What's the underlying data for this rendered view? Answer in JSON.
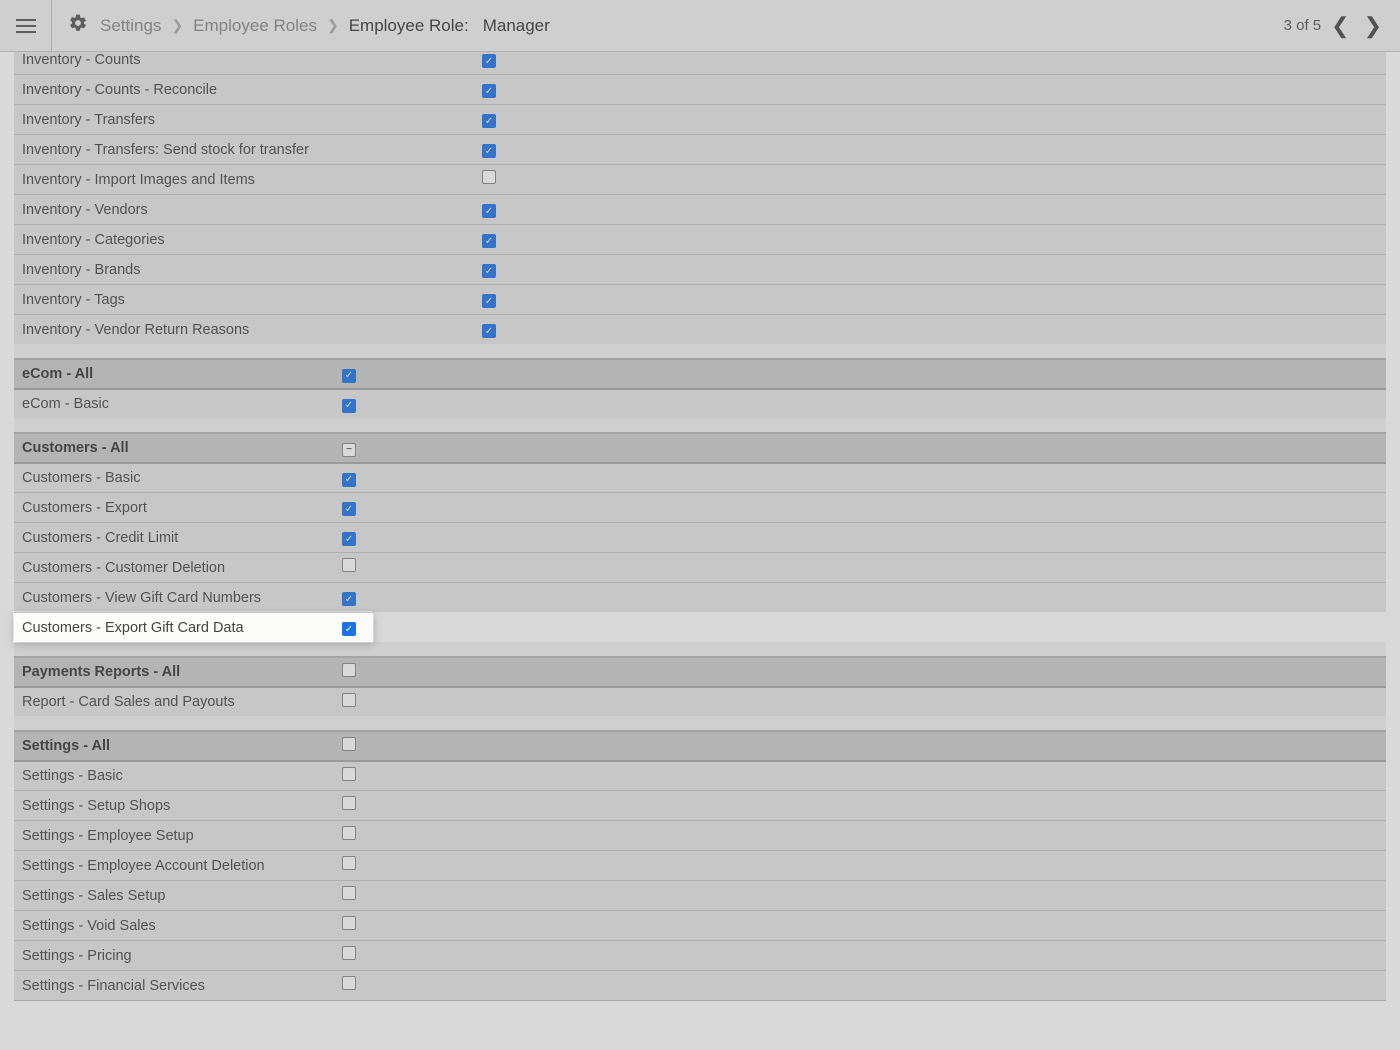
{
  "header": {
    "breadcrumb": {
      "l1": "Settings",
      "l2": "Employee Roles",
      "l3_label": "Employee Role:",
      "l3_value": "Manager"
    },
    "pager": {
      "text": "3 of 5"
    }
  },
  "sections": [
    {
      "kind": "group_continue",
      "rows": [
        {
          "label": "Inventory - Counts",
          "checked": true
        },
        {
          "label": "Inventory - Counts - Reconcile",
          "checked": true
        },
        {
          "label": "Inventory - Transfers",
          "checked": true
        },
        {
          "label": "Inventory - Transfers: Send stock for transfer",
          "checked": true
        },
        {
          "label": "Inventory - Import Images and Items",
          "checked": false
        },
        {
          "label": "Inventory - Vendors",
          "checked": true
        },
        {
          "label": "Inventory - Categories",
          "checked": true
        },
        {
          "label": "Inventory - Brands",
          "checked": true
        },
        {
          "label": "Inventory - Tags",
          "checked": true
        },
        {
          "label": "Inventory - Vendor Return Reasons",
          "checked": true
        }
      ]
    },
    {
      "kind": "section",
      "header": {
        "label": "eCom - All",
        "state": "checked"
      },
      "rows": [
        {
          "label": "eCom - Basic",
          "checked": true
        }
      ]
    },
    {
      "kind": "section",
      "header": {
        "label": "Customers - All",
        "state": "indeterminate"
      },
      "rows": [
        {
          "label": "Customers - Basic",
          "checked": true
        },
        {
          "label": "Customers - Export",
          "checked": true
        },
        {
          "label": "Customers - Credit Limit",
          "checked": true
        },
        {
          "label": "Customers - Customer Deletion",
          "checked": false
        },
        {
          "label": "Customers - View Gift Card Numbers",
          "checked": true
        },
        {
          "label": "Customers - Export Gift Card Data",
          "checked": true,
          "highlight": true
        }
      ]
    },
    {
      "kind": "section",
      "header": {
        "label": "Payments Reports - All",
        "state": "unchecked"
      },
      "rows": [
        {
          "label": "Report - Card Sales and Payouts",
          "checked": false
        }
      ]
    },
    {
      "kind": "section",
      "header": {
        "label": "Settings - All",
        "state": "unchecked"
      },
      "rows": [
        {
          "label": "Settings - Basic",
          "checked": false
        },
        {
          "label": "Settings - Setup Shops",
          "checked": false
        },
        {
          "label": "Settings - Employee Setup",
          "checked": false
        },
        {
          "label": "Settings - Employee Account Deletion",
          "checked": false
        },
        {
          "label": "Settings - Sales Setup",
          "checked": false
        },
        {
          "label": "Settings - Void Sales",
          "checked": false
        },
        {
          "label": "Settings - Pricing",
          "checked": false
        },
        {
          "label": "Settings - Financial Services",
          "checked": false
        }
      ]
    }
  ]
}
